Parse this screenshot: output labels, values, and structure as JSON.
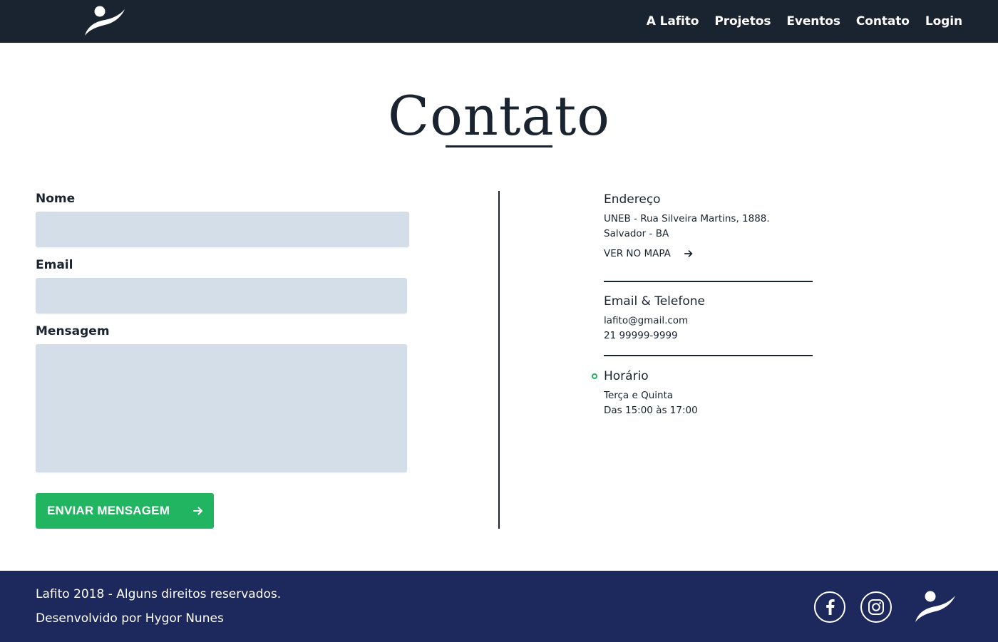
{
  "nav": {
    "links": [
      "A Lafito",
      "Projetos",
      "Eventos",
      "Contato",
      "Login"
    ]
  },
  "title": "Contato",
  "form": {
    "name_label": "Nome",
    "email_label": "Email",
    "message_label": "Mensagem",
    "name_value": "",
    "email_value": "",
    "message_value": "",
    "submit_label": "ENVIAR MENSAGEM"
  },
  "info": {
    "address": {
      "title": "Endereço",
      "line1": "UNEB - Rua Silveira Martins, 1888.",
      "line2": "Salvador - BA",
      "map_link": "VER NO MAPA"
    },
    "contact": {
      "title": "Email & Telefone",
      "email": "lafito@gmail.com",
      "phone": "21 99999-9999"
    },
    "hours": {
      "title": "Horário",
      "days": "Terça e Quinta",
      "time": "Das 15:00 às 17:00"
    }
  },
  "footer": {
    "copyright": "Lafito 2018 - Alguns direitos reservados.",
    "credits": "Desenvolvido por Hygor Nunes"
  },
  "icons": {
    "logo": "lafito-logo-icon",
    "arrow": "arrow-right-icon",
    "facebook": "facebook-icon",
    "instagram": "instagram-icon",
    "status": "status-dot-icon"
  },
  "colors": {
    "navbar": "#1a2330",
    "accent": "#21b561",
    "input_bg": "#d4dee8",
    "footer": "#1d285c",
    "text": "#1a2330"
  }
}
